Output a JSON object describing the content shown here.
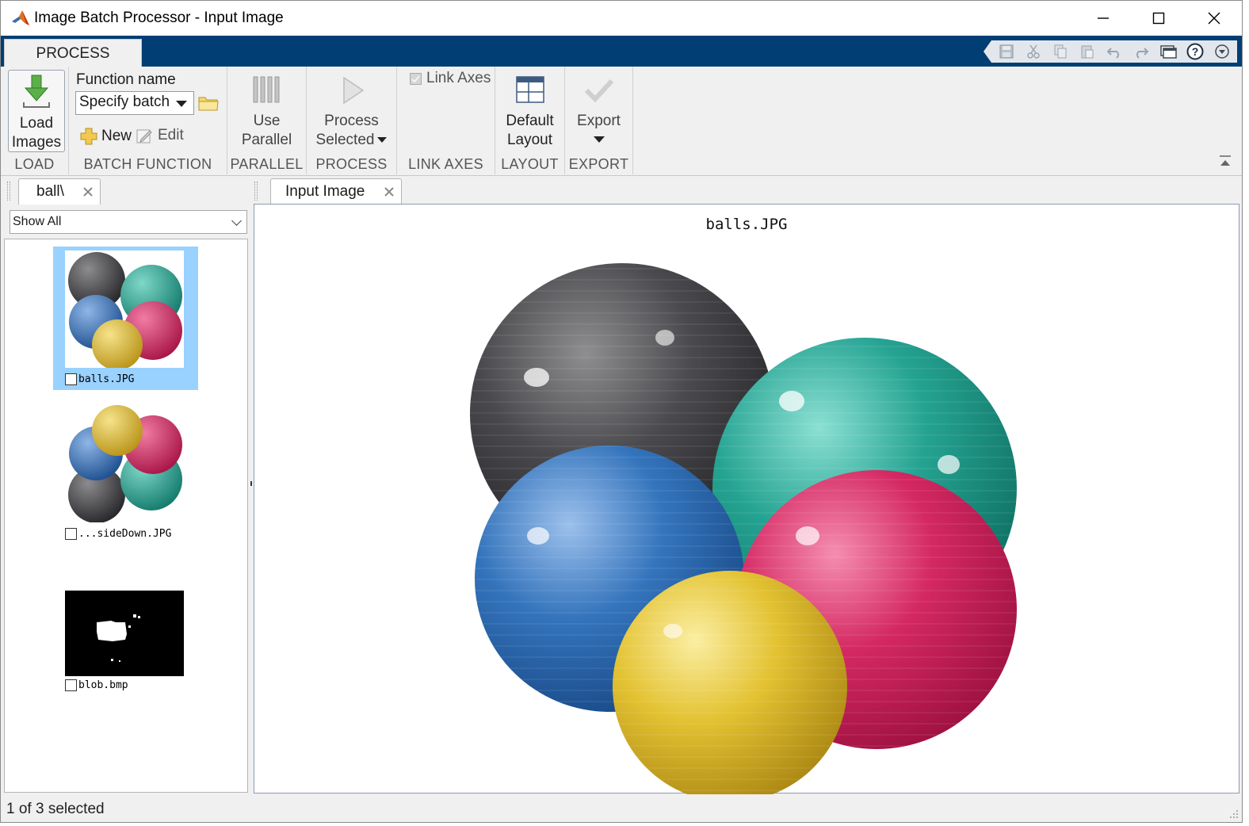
{
  "window": {
    "title": "Image Batch Processor - Input Image"
  },
  "ribbon": {
    "tab": "PROCESS",
    "load": {
      "label_line1": "Load",
      "label_line2": "Images",
      "group": "LOAD"
    },
    "batch_function": {
      "function_name_label": "Function name",
      "function_value": "Specify batch",
      "new_label": "New",
      "edit_label": "Edit",
      "group": "BATCH FUNCTION"
    },
    "parallel": {
      "label_line1": "Use",
      "label_line2": "Parallel",
      "group": "PARALLEL"
    },
    "process": {
      "label_line1": "Process",
      "label_line2": "Selected",
      "group": "PROCESS"
    },
    "link_axes": {
      "label": "Link Axes",
      "group": "LINK AXES"
    },
    "layout": {
      "label_line1": "Default",
      "label_line2": "Layout",
      "group": "LAYOUT"
    },
    "export": {
      "label": "Export",
      "group": "EXPORT"
    }
  },
  "quick_access_icons": [
    "save-icon",
    "cut-icon",
    "copy-icon",
    "paste-icon",
    "undo-icon",
    "redo-icon",
    "window-switch-icon",
    "help-icon",
    "dropdown-arrow-icon"
  ],
  "left_panel": {
    "tab_label": "ball\\",
    "filter_value": "Show All",
    "thumbnails": [
      {
        "caption": "balls.JPG",
        "selected": true,
        "checked": false
      },
      {
        "caption": "...sideDown.JPG",
        "selected": false,
        "checked": false
      },
      {
        "caption": "blob.bmp",
        "selected": false,
        "checked": false
      }
    ]
  },
  "main_panel": {
    "tab_label": "Input Image",
    "figure_title": "balls.JPG"
  },
  "status": {
    "text": "1 of 3 selected"
  },
  "colors": {
    "ribbon_tabstrip": "#003e74",
    "selection": "#99d1ff",
    "ball_black": "#3a3a3c",
    "ball_teal": "#1e9c8c",
    "ball_blue": "#2f6fb4",
    "ball_pink": "#d2235f",
    "ball_yellow": "#e2c02e"
  }
}
